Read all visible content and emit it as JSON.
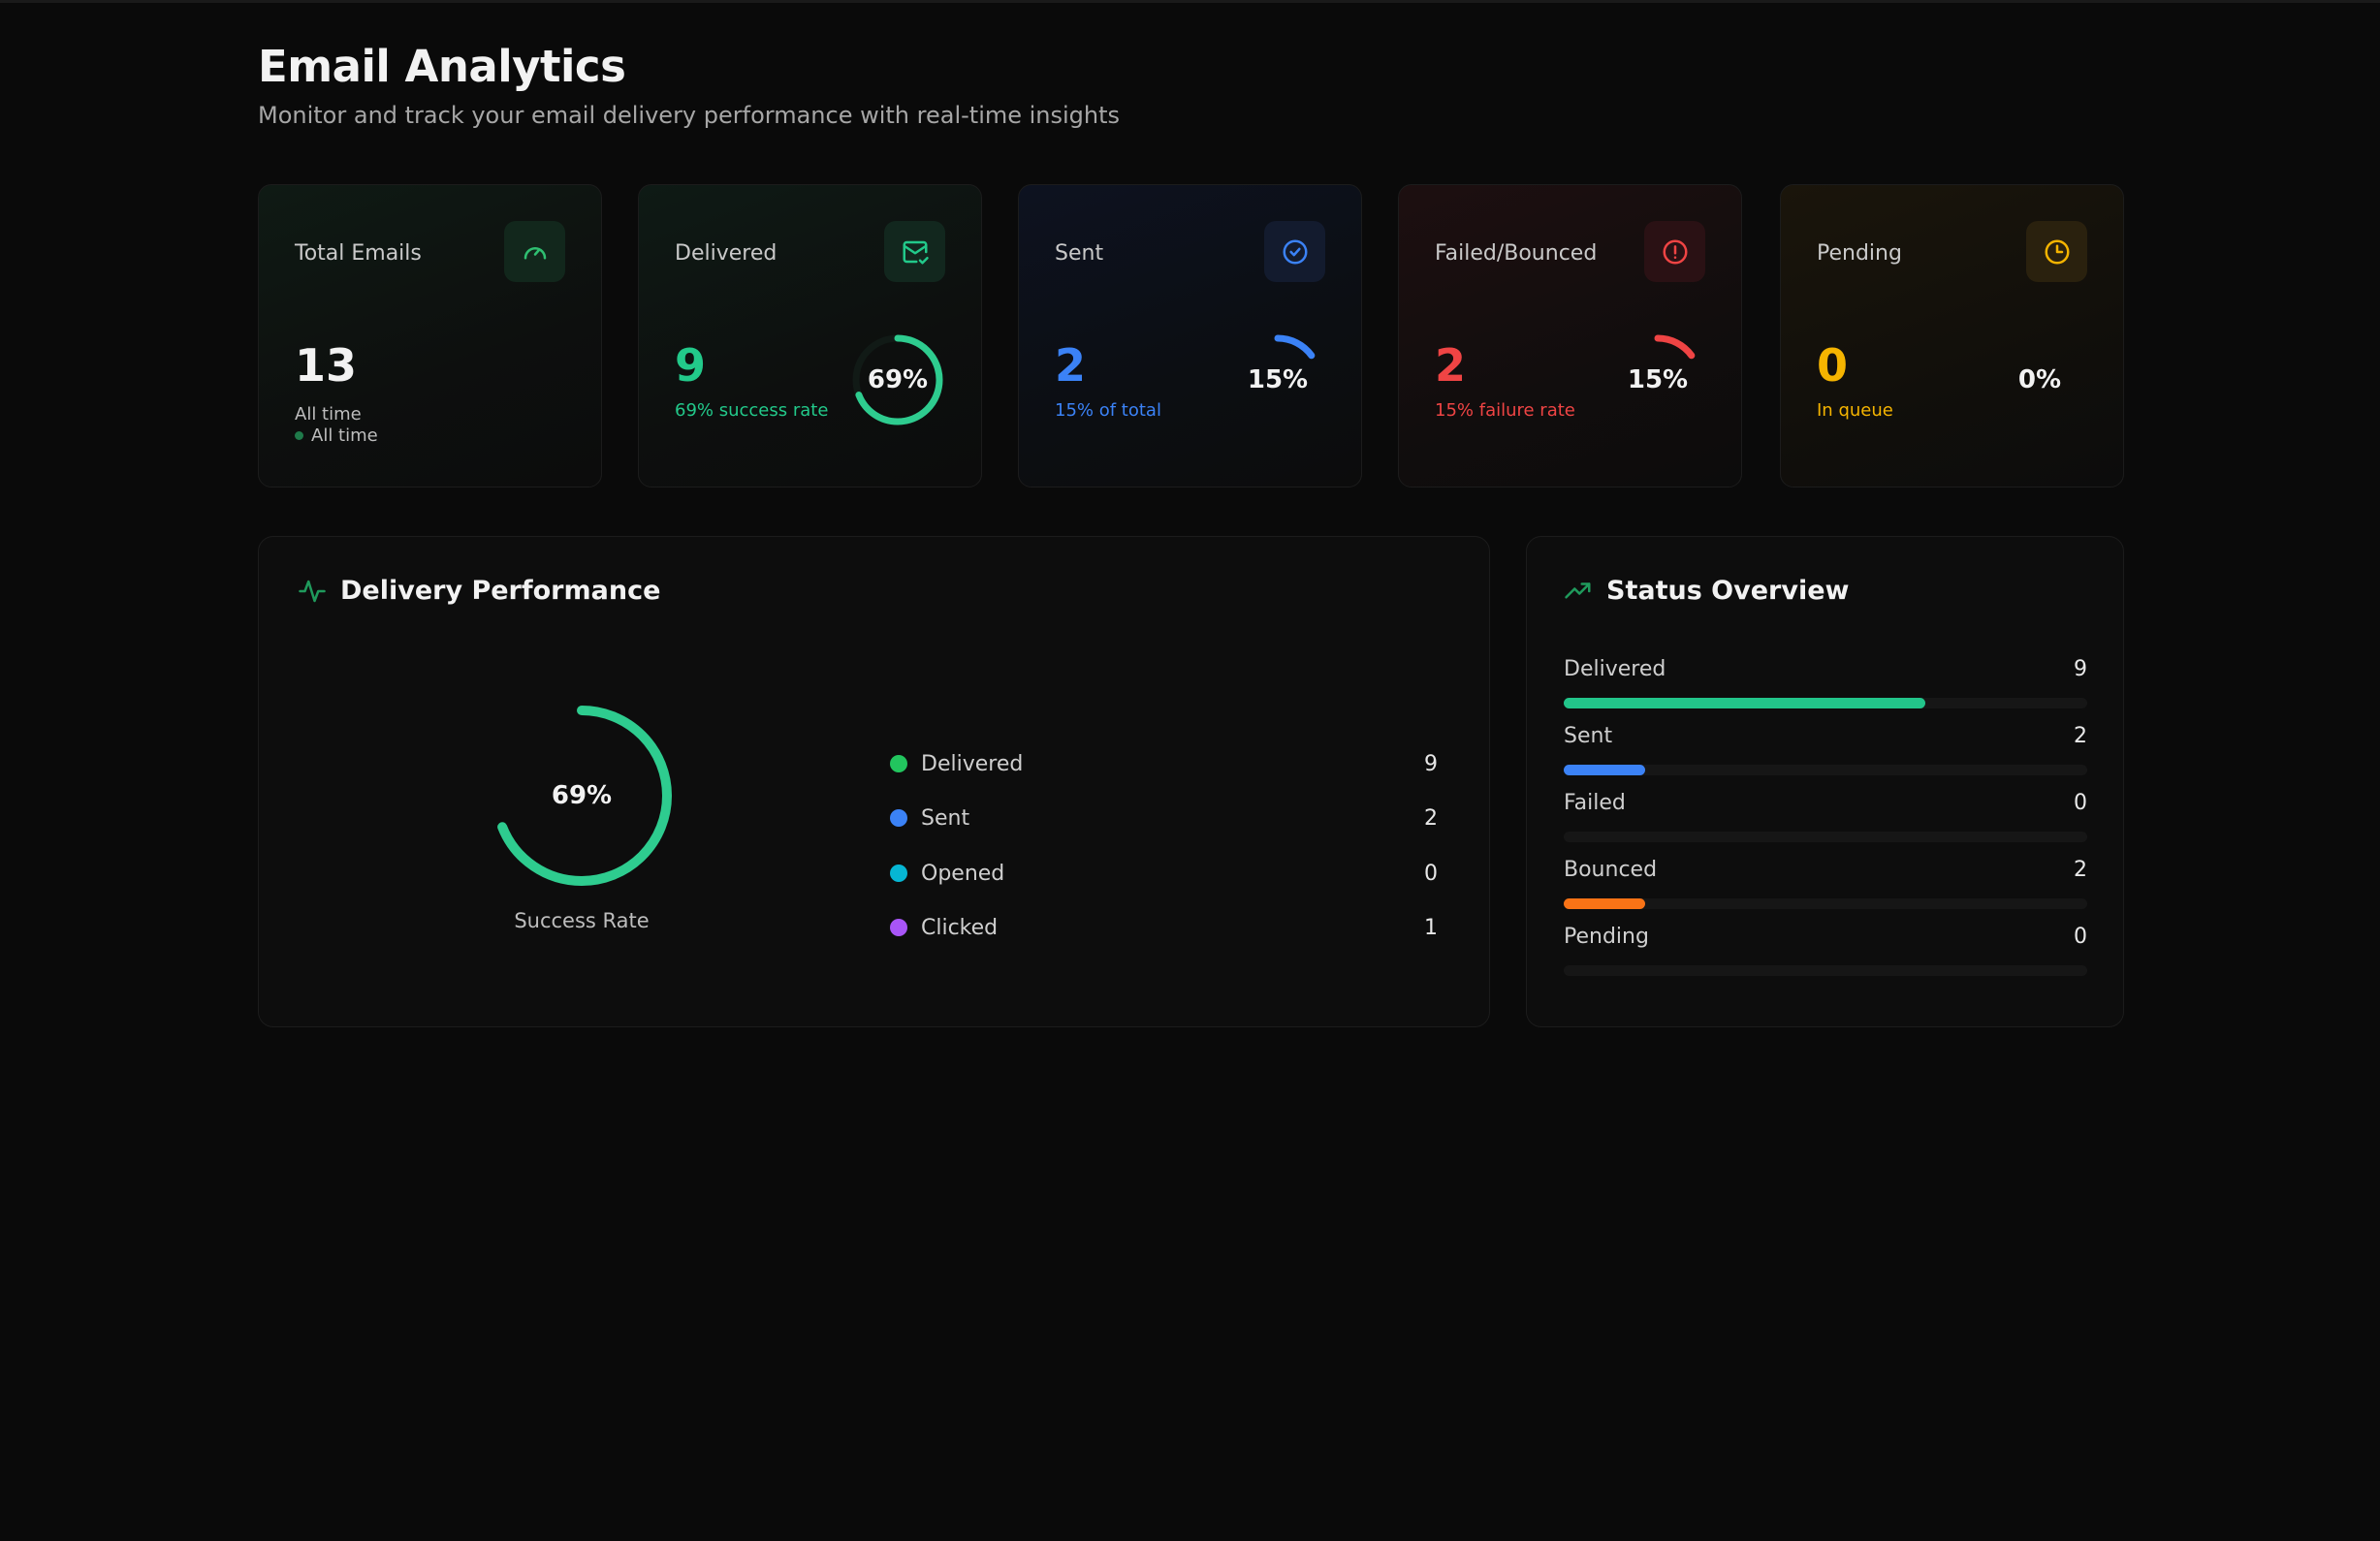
{
  "header": {
    "title": "Email Analytics",
    "subtitle": "Monitor and track your email delivery performance with real-time insights"
  },
  "cards": [
    {
      "label": "Total Emails",
      "value": "13",
      "sub": "All time",
      "sub2": "All time",
      "icon": "speedometer-icon",
      "color": "#2fbf71"
    },
    {
      "label": "Delivered",
      "value": "9",
      "sub": "69% success rate",
      "percent_label": "69%",
      "percent": 69,
      "icon": "mail-check-icon",
      "color": "#22c98a"
    },
    {
      "label": "Sent",
      "value": "2",
      "sub": "15% of total",
      "percent_label": "15%",
      "percent": 15,
      "icon": "check-circle-icon",
      "color": "#3b82f6"
    },
    {
      "label": "Failed/Bounced",
      "value": "2",
      "sub": "15% failure rate",
      "percent_label": "15%",
      "percent": 15,
      "icon": "alert-circle-icon",
      "color": "#ef4444"
    },
    {
      "label": "Pending",
      "value": "0",
      "sub": "In queue",
      "percent_label": "0%",
      "percent": 0,
      "icon": "clock-icon",
      "color": "#f5b400"
    }
  ],
  "delivery_performance": {
    "title": "Delivery Performance",
    "rate_label": "69%",
    "rate": 69,
    "caption": "Success Rate",
    "legend": [
      {
        "label": "Delivered",
        "value": "9",
        "color": "#22c55e"
      },
      {
        "label": "Sent",
        "value": "2",
        "color": "#3b82f6"
      },
      {
        "label": "Opened",
        "value": "0",
        "color": "#06b6d4"
      },
      {
        "label": "Clicked",
        "value": "1",
        "color": "#a855f7"
      }
    ]
  },
  "status_overview": {
    "title": "Status Overview",
    "rows": [
      {
        "label": "Delivered",
        "value": "9",
        "fraction": 0.69,
        "color": "#22c58a"
      },
      {
        "label": "Sent",
        "value": "2",
        "fraction": 0.155,
        "color": "#3b82f6"
      },
      {
        "label": "Failed",
        "value": "0",
        "fraction": 0,
        "color": "#ef4444"
      },
      {
        "label": "Bounced",
        "value": "2",
        "fraction": 0.155,
        "color": "#f97316"
      },
      {
        "label": "Pending",
        "value": "0",
        "fraction": 0,
        "color": "#f5b400"
      }
    ]
  }
}
